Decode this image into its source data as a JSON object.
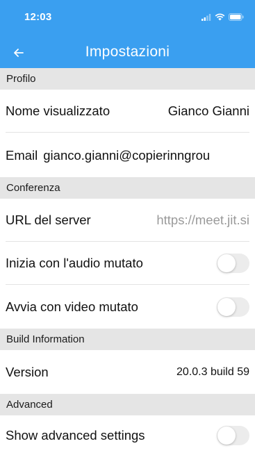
{
  "status_bar": {
    "time": "12:03",
    "icons": [
      "signal-icon",
      "wifi-icon",
      "battery-icon"
    ]
  },
  "nav": {
    "title": "Impostazioni",
    "back_icon": "arrow-left-icon"
  },
  "colors": {
    "accent": "#3a9ff0",
    "section_bg": "#e5e5e5",
    "placeholder": "#9a9a9a",
    "toggle_off": "#ececec"
  },
  "sections": {
    "profile": {
      "header": "Profilo",
      "display_name_label": "Nome visualizzato",
      "display_name_value": "Gianco Gianni",
      "email_label": "Email",
      "email_value": "gianco.gianni@copierinngrou"
    },
    "conference": {
      "header": "Conferenza",
      "server_url_label": "URL del server",
      "server_url_placeholder": "https://meet.jit.si",
      "start_audio_muted_label": "Inizia con l'audio mutato",
      "start_audio_muted": false,
      "start_video_muted_label": "Avvia con video mutato",
      "start_video_muted": false
    },
    "build": {
      "header": "Build Information",
      "version_label": "Version",
      "version_value": "20.0.3 build 59"
    },
    "advanced": {
      "header": "Advanced",
      "show_advanced_label": "Show advanced settings",
      "show_advanced": false
    }
  }
}
